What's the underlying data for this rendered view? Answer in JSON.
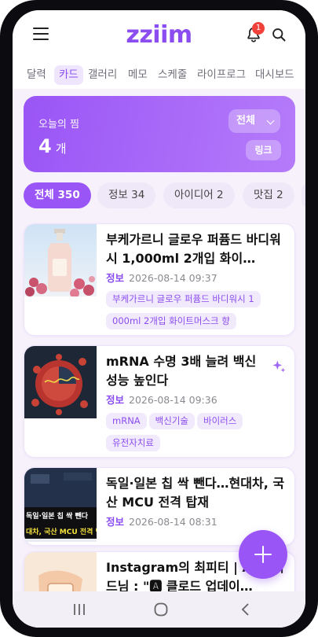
{
  "app": {
    "logo": "zziim",
    "notification_count": "1"
  },
  "tabs": [
    {
      "label": "달력",
      "active": false
    },
    {
      "label": "카드",
      "active": true
    },
    {
      "label": "갤러리",
      "active": false
    },
    {
      "label": "메모",
      "active": false
    },
    {
      "label": "스케줄",
      "active": false
    },
    {
      "label": "라이프로그",
      "active": false
    },
    {
      "label": "대시보드",
      "active": false
    }
  ],
  "summary": {
    "label": "오늘의 찜",
    "count": "4",
    "unit": "개",
    "filter_label": "전체",
    "link_label": "링크"
  },
  "filters": [
    {
      "label": "전체 350",
      "active": true
    },
    {
      "label": "정보 34",
      "active": false
    },
    {
      "label": "아이디어 2",
      "active": false
    },
    {
      "label": "맛집 2",
      "active": false
    }
  ],
  "cards": [
    {
      "title": "부케가르니 글로우 퍼퓸드 바디워시 1,000ml 2개입 화이…",
      "category": "정보",
      "timestamp": "2026-08-14 09:37",
      "tags": [
        "부케가르니 글로우 퍼퓸드 바디워시 1",
        "000ml 2개입 화이트머스크 향"
      ]
    },
    {
      "title": "mRNA 수명 3배 늘려 백신 성능 높인다",
      "category": "정보",
      "timestamp": "2026-08-14 09:36",
      "tags": [
        "mRNA",
        "백신기술",
        "바이러스",
        "유전자치료"
      ]
    },
    {
      "title": "독일·일본 칩 싹 뺀다…현대차, 국산 MCU 전격 탑재",
      "category": "정보",
      "timestamp": "2026-08-14 08:31",
      "tags": []
    },
    {
      "title": "Instagram의 최피티 | AI 가이드님 : \"🅰 클로드 업데이…",
      "category": "",
      "timestamp": "",
      "tags": []
    }
  ],
  "thumb_text": {
    "line1": "독일·일본 칩 싹 뺀다",
    "line2": "대차, 국산 MCU 전격 탑"
  },
  "colors": {
    "accent": "#9a55f6",
    "accent_dark": "#8b4df0",
    "chip_bg": "#efe8f8",
    "tag_bg": "#f1eafc",
    "badge": "#f0413a"
  },
  "icons": [
    "menu-icon",
    "bell-icon",
    "search-icon",
    "chevron-down-icon",
    "sparkle-icon",
    "plus-icon",
    "recent-apps-icon",
    "home-icon",
    "back-icon"
  ]
}
